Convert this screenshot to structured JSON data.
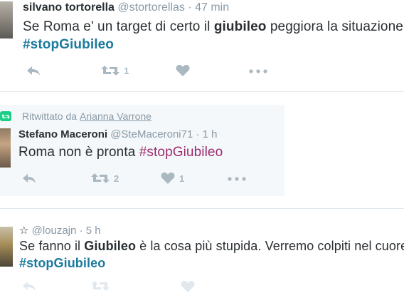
{
  "tweets": [
    {
      "name": "silvano tortorella",
      "handle": "@stortorellas",
      "separator": "·",
      "time": "47 min",
      "text_parts": [
        "Se Roma e' un target di certo il ",
        "giubileo",
        " peggiora la situazione!!!"
      ],
      "hashtag": "#stopGiubileo",
      "retweet_count": "1",
      "like_count": ""
    },
    {
      "retweeted_by_label": "Ritwittato da",
      "retweeted_by": "Arianna Varrone",
      "name": "Stefano Maceroni",
      "handle": "@SteMaceroni71",
      "separator": "·",
      "time": "1 h",
      "text_before": "Roma non è pronta ",
      "hashtag": "#stopGiubileo",
      "retweet_count": "2",
      "like_count": "1"
    },
    {
      "star": "☆",
      "handle": "@louzajn",
      "separator": "·",
      "time": "5 h",
      "text_parts": [
        "Se fanno il ",
        "Giubileo",
        " è la cosa più stupida. Verremo colpiti nel cuore"
      ],
      "hashtag": "#stopGiubileo"
    }
  ],
  "colors": {
    "accent_hashtag": "#1b7a9d",
    "purple_hashtag": "#9b2b6d",
    "action_gray": "#aab8c2",
    "retweet_green": "#19cf86",
    "highlight_bg": "#f5f8fa"
  },
  "icons": [
    "reply-icon",
    "retweet-icon",
    "like-icon",
    "more-icon",
    "retweet-badge-icon",
    "avatar"
  ]
}
